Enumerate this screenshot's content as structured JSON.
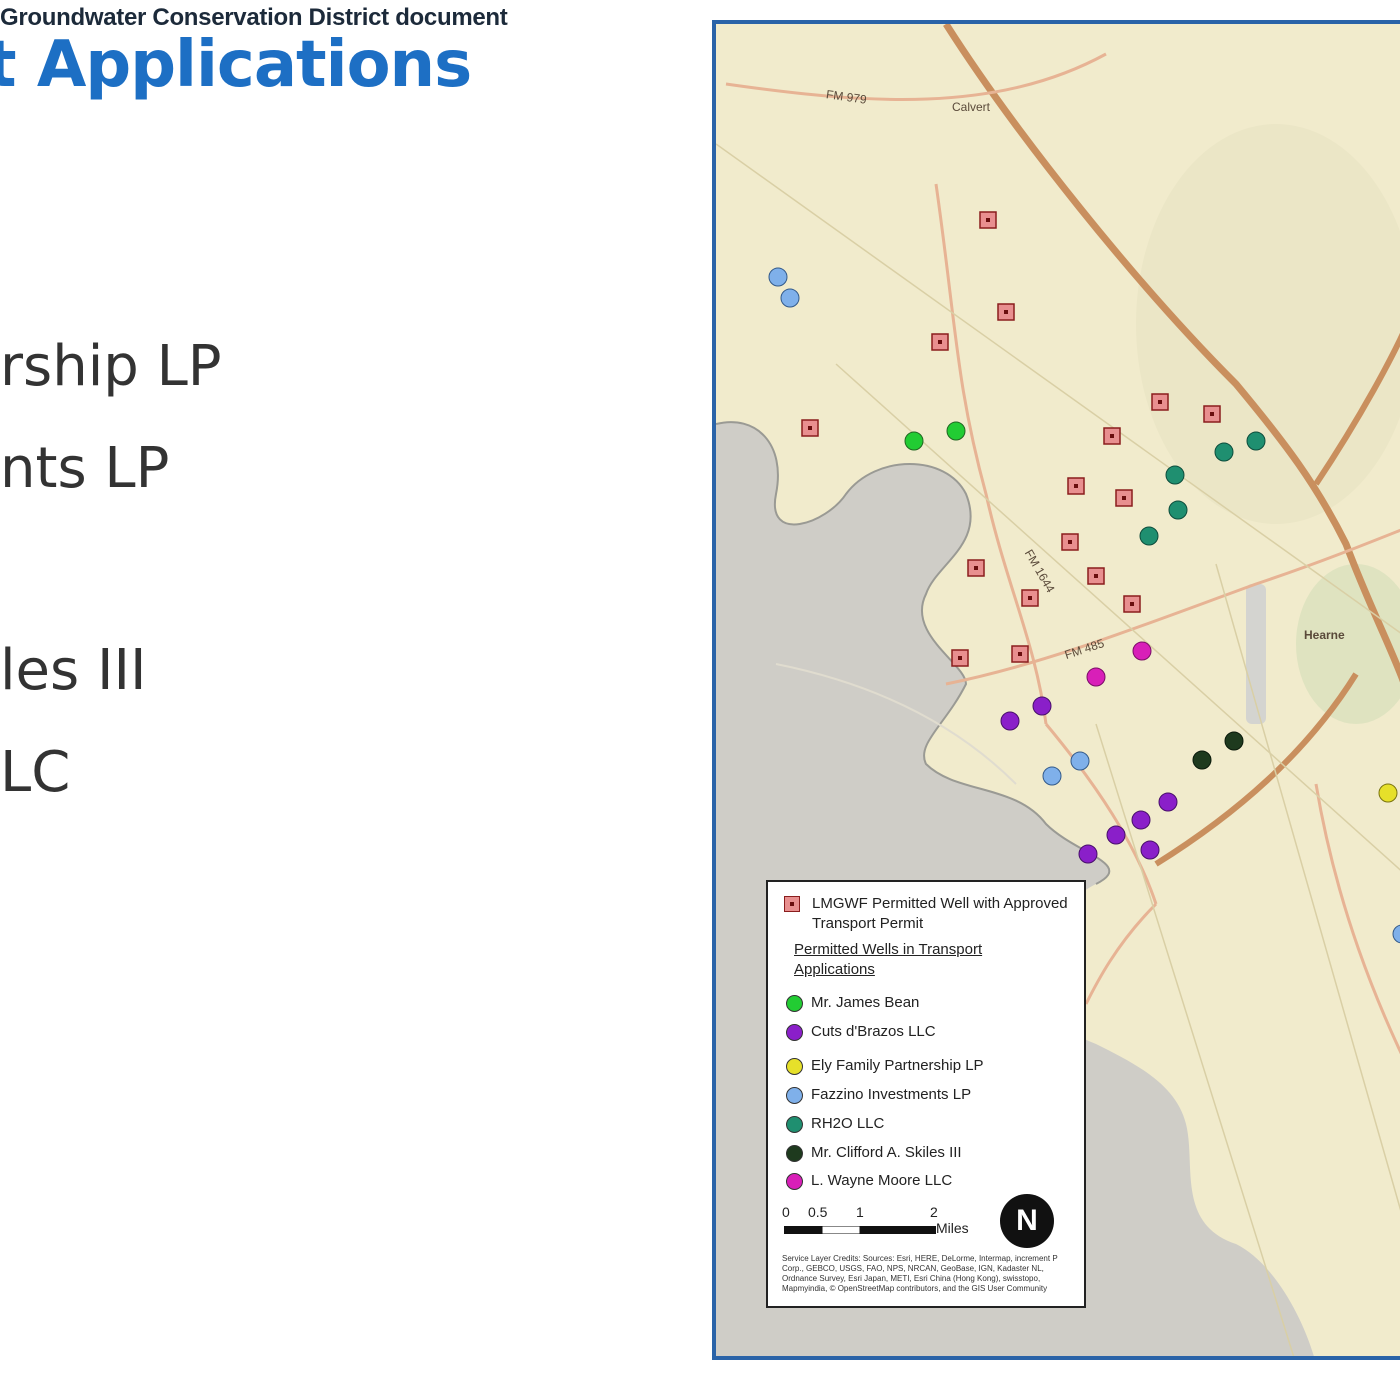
{
  "slide": {
    "header_note": "Groundwater Conservation District document",
    "title": "t Applications",
    "bullets": [
      "rship LP",
      "nts LP",
      "les III",
      "LC"
    ]
  },
  "map": {
    "place_labels": [
      "Calvert",
      "Hearne"
    ],
    "road_labels": [
      "FM 979",
      "FM 1644",
      "FM 485"
    ],
    "legend": {
      "permitted_well_label": "LMGWF Permitted Well with Approved Transport Permit",
      "subheading": "Permitted Wells in Transport Applications",
      "entries": [
        {
          "label": "Mr. James Bean",
          "color": "#22cc33"
        },
        {
          "label": "Cuts d'Brazos LLC",
          "color": "#8a1fc9"
        },
        {
          "label": "Ely Family Partnership LP",
          "color": "#e6e02a"
        },
        {
          "label": "Fazzino Investments LP",
          "color": "#7fb0ea"
        },
        {
          "label": "RH2O LLC",
          "color": "#1f8f70"
        },
        {
          "label": "Mr. Clifford A. Skiles III",
          "color": "#1e3a1e"
        },
        {
          "label": "L. Wayne Moore LLC",
          "color": "#d81fb8"
        }
      ],
      "scale_labels": [
        "0",
        "0.5",
        "1",
        "2"
      ],
      "scale_unit": "Miles",
      "north_symbol": "N",
      "credits": "Service Layer Credits: Sources: Esri, HERE, DeLorme, Intermap, increment P Corp., GEBCO, USGS, FAO, NPS, NRCAN, GeoBase, IGN, Kadaster NL, Ordnance Survey, Esri Japan, METI, Esri China (Hong Kong), swisstopo, Mapmyindia, © OpenStreetMap contributors, and the GIS User Community"
    }
  }
}
